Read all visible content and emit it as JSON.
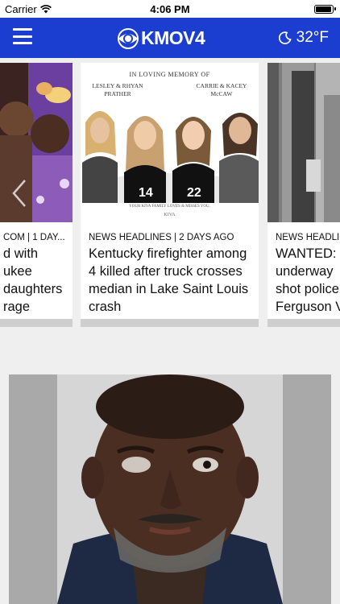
{
  "status_bar": {
    "carrier": "Carrier",
    "time": "4:06 PM",
    "battery_level": 1.0
  },
  "app_bar": {
    "background": "#1b3ed0",
    "menu_icon": "hamburger-menu-icon",
    "brand": "KMOV4",
    "brand_icon": "cbs-eye-icon",
    "weather": {
      "icon": "moon-icon",
      "temperature": "32°F"
    }
  },
  "carousel": {
    "prev_icon": "chevron-left-icon",
    "cards": [
      {
        "meta": "COM | 1 DAY...",
        "headline_lines": [
          "d with",
          "ukee",
          "daughters",
          "rage"
        ]
      },
      {
        "meta": "NEWS HEADLINES | 2 DAYS AGO",
        "headline": "Kentucky firefighter among 4 killed after truck crosses median in Lake Saint Louis crash",
        "image": {
          "title": "IN LOVING MEMORY OF",
          "names_left": [
            "LESLEY & RHYAN",
            "PRATHER"
          ],
          "names_right": [
            "CARRIE & KACEY",
            "McCAW"
          ],
          "jersey_numbers": [
            "14",
            "22"
          ],
          "tagline": "YOUR KIVA FAMILY LOVES & MISSES YOU.",
          "logo": "KIVA"
        }
      },
      {
        "meta": "NEWS HEADLI",
        "headline_lines": [
          "WANTED:",
          "underway",
          "shot police",
          "Ferguson V"
        ]
      }
    ]
  }
}
